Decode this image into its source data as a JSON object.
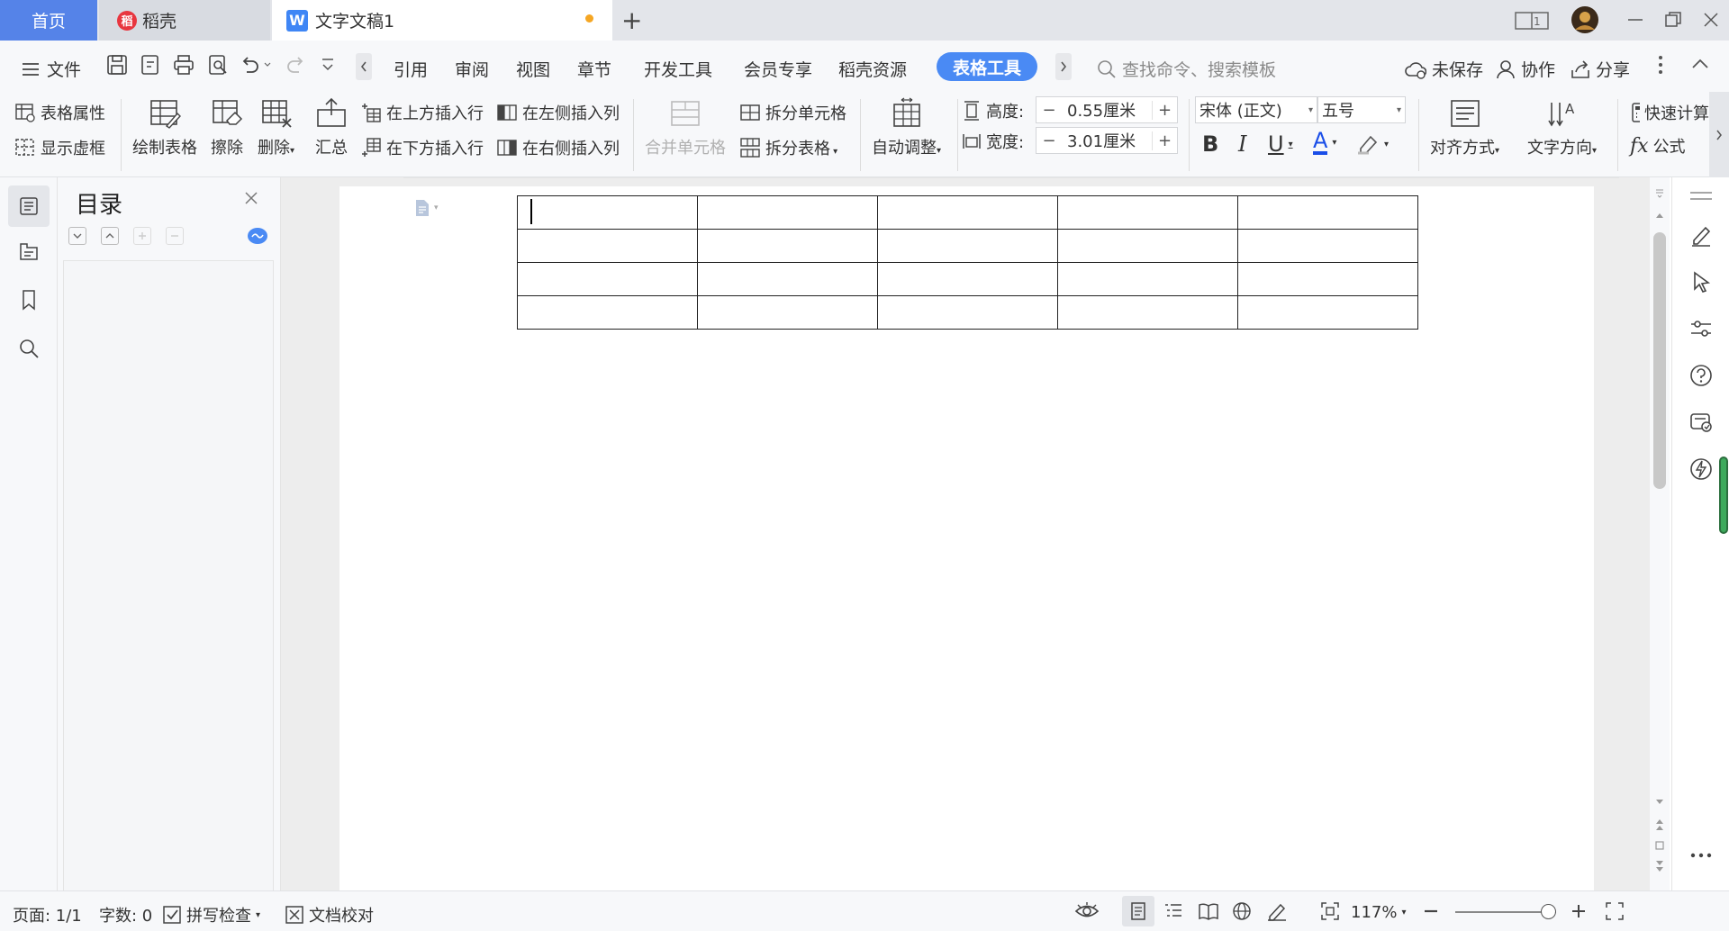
{
  "tabs": {
    "home": "首页",
    "daoke": "稻壳",
    "document": "文字文稿1",
    "new_tab": "+"
  },
  "menu": {
    "file": "文件",
    "items": [
      "引用",
      "审阅",
      "视图",
      "章节",
      "开发工具",
      "会员专享",
      "稻壳资源"
    ],
    "active_tab": "表格工具",
    "search_placeholder": "查找命令、搜索模板",
    "unsaved": "未保存",
    "collaborate": "协作",
    "share": "分享"
  },
  "ribbon": {
    "table_properties": "表格属性",
    "show_gridlines": "显示虚框",
    "draw_table": "绘制表格",
    "erase": "擦除",
    "delete": "删除",
    "summarize": "汇总",
    "insert_row_above": "在上方插入行",
    "insert_row_below": "在下方插入行",
    "insert_col_left": "在左侧插入列",
    "insert_col_right": "在右侧插入列",
    "merge_cells": "合并单元格",
    "split_cells": "拆分单元格",
    "split_table": "拆分表格",
    "auto_fit": "自动调整",
    "height_label": "高度:",
    "height_value": "0.55厘米",
    "width_label": "宽度:",
    "width_value": "3.01厘米",
    "font_name": "宋体 (正文)",
    "font_size": "五号",
    "bold": "B",
    "italic": "I",
    "underline": "U",
    "font_color": "A",
    "alignment": "对齐方式",
    "text_direction": "文字方向",
    "quick_calc": "快速计算",
    "formula": "公式",
    "fx": "fx"
  },
  "toc": {
    "title": "目录"
  },
  "document": {
    "table": {
      "rows": 4,
      "cols": 5
    }
  },
  "status": {
    "page": "页面: 1/1",
    "word_count": "字数: 0",
    "spell_check": "拼写检查",
    "proofread": "文档校对",
    "zoom": "117%"
  },
  "colors": {
    "accent": "#4a8af4",
    "home_tab": "#5583e8",
    "tab_bar": "#e3e5ea"
  }
}
